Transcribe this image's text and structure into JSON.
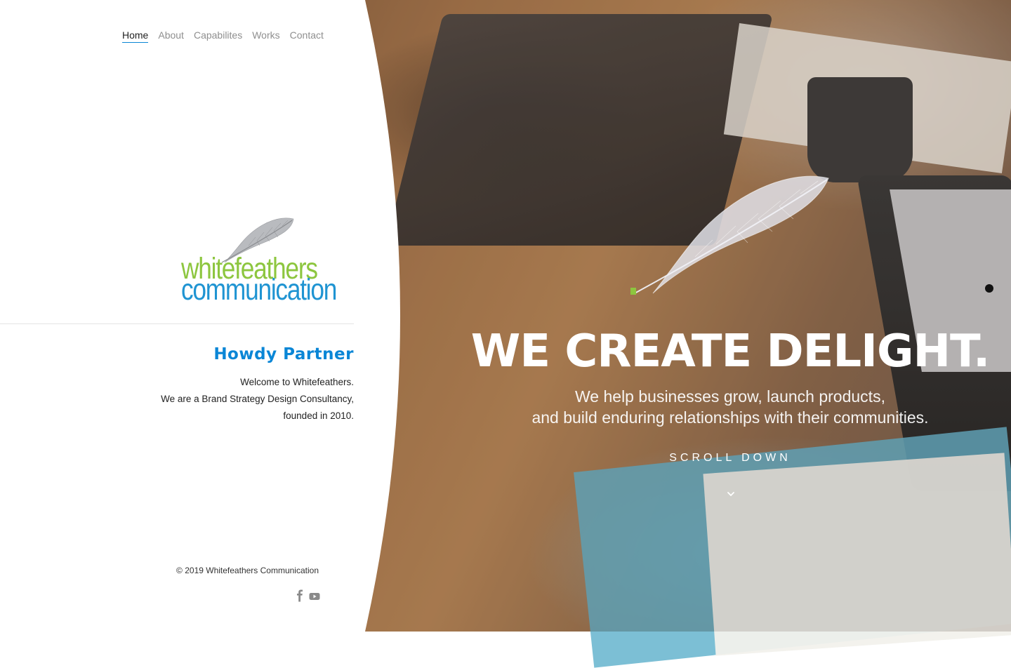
{
  "nav": {
    "items": [
      {
        "label": "Home",
        "active": true
      },
      {
        "label": "About",
        "active": false
      },
      {
        "label": "Capabilites",
        "active": false
      },
      {
        "label": "Works",
        "active": false
      },
      {
        "label": "Contact",
        "active": false
      }
    ]
  },
  "logo": {
    "line1": "whitefeathers",
    "line2": "communication",
    "colors": {
      "green": "#8dc63f",
      "blue": "#1f94d2"
    }
  },
  "intro": {
    "heading": "Howdy Partner",
    "lines": [
      "Welcome to Whitefeathers.",
      "We are a Brand Strategy Design Consultancy,",
      "founded in 2010."
    ]
  },
  "footer": {
    "copyright": "© 2019 Whitefeathers Communication",
    "social": [
      "facebook-icon",
      "youtube-icon"
    ]
  },
  "hero": {
    "title": "WE CREATE DELIGHT.",
    "subtitle_lines": [
      "We help businesses grow, launch products,",
      "and build enduring relationships with their communities."
    ],
    "scroll_label": "SCROLL DOWN"
  },
  "colors": {
    "accent": "#0a86d6",
    "nav_inactive": "#8f8f8f",
    "text": "#222222"
  }
}
